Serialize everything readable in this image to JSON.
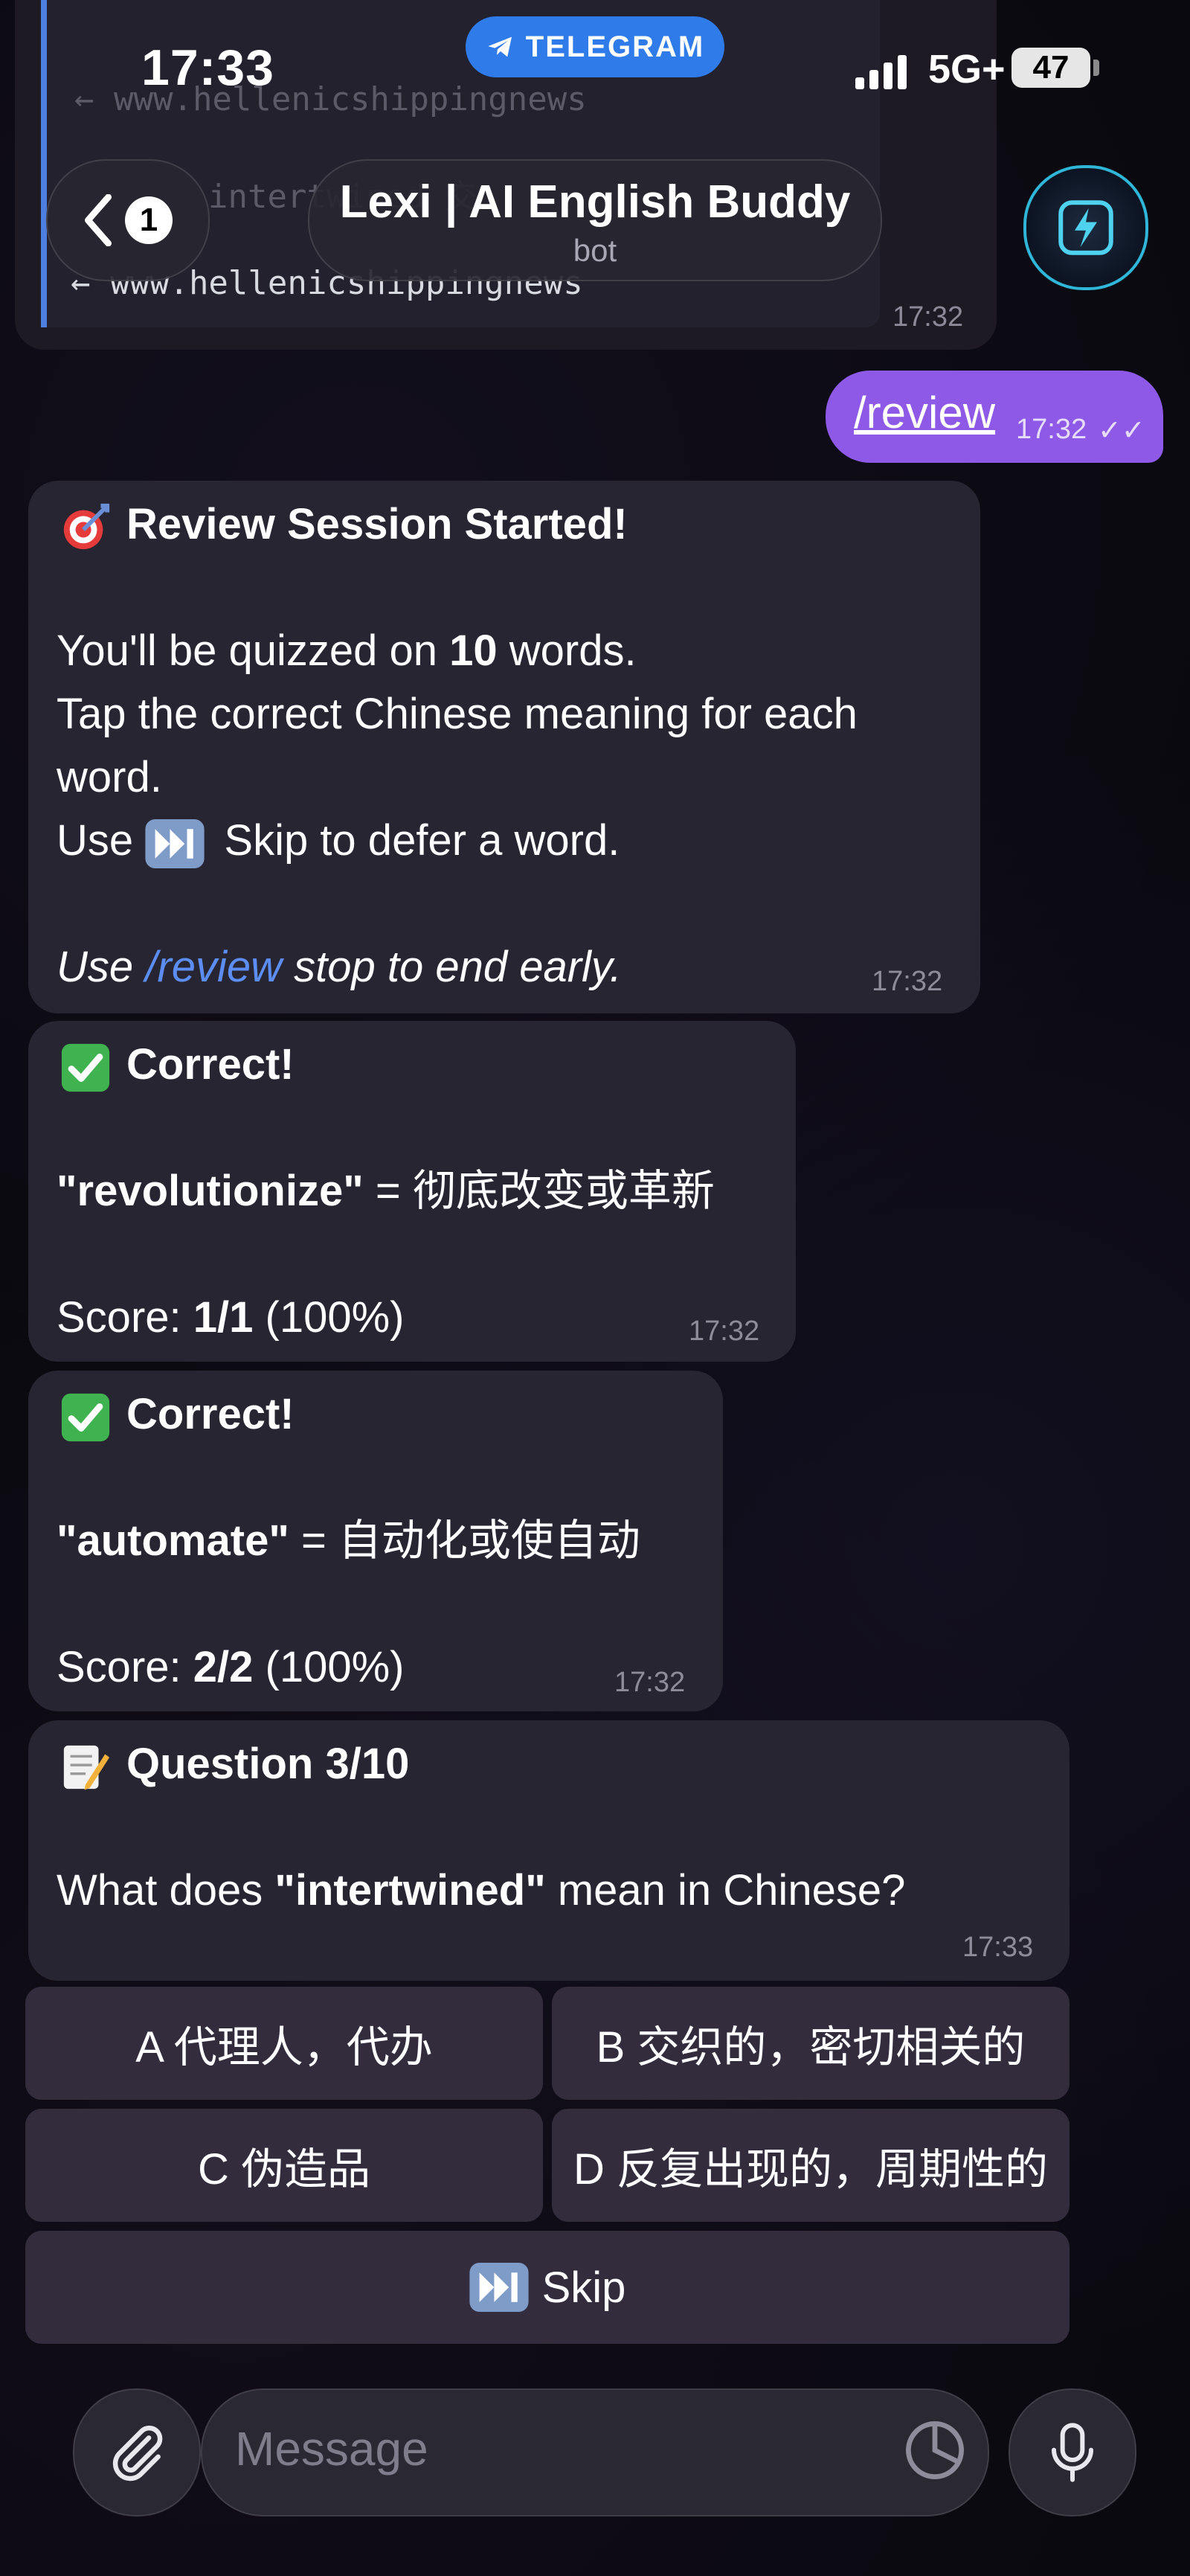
{
  "status": {
    "time": "17:33",
    "telegram_label": "TELEGRAM",
    "network": "5G+",
    "battery": "47"
  },
  "header": {
    "back_count": "1",
    "title": "Lexi | AI English Buddy",
    "subtitle": "bot"
  },
  "prev_message": {
    "link_text": "← www.hellenicshippingnews",
    "ghost_line_1": "← www.hellenicshippingnews",
    "ghost_line_2": "intertwined  交",
    "time": "17:32"
  },
  "outgoing": {
    "text": "/review",
    "time": "17:32"
  },
  "messages": {
    "m1": {
      "title": "Review Session Started!",
      "line1_pre": "You'll be quizzed on ",
      "line1_bold": "10",
      "line1_post": " words.",
      "line2": "Tap the correct Chinese meaning for each",
      "line3": "word.",
      "line4_pre": "Use ",
      "line4_post": " Skip to defer a word.",
      "line5_pre": "Use ",
      "line5_link": "/review",
      "line5_post": " stop to end early.",
      "time": "17:32"
    },
    "m2": {
      "title": "Correct!",
      "word": "\"revolutionize\"",
      "meaning": " = 彻底改变或革新",
      "score_label": "Score: ",
      "score_value": "1/1",
      "score_pct": " (100%)",
      "time": "17:32"
    },
    "m3": {
      "title": "Correct!",
      "word": "\"automate\"",
      "meaning": " = 自动化或使自动",
      "score_label": "Score: ",
      "score_value": "2/2",
      "score_pct": " (100%)",
      "time": "17:32"
    },
    "m4": {
      "title": "Question 3/10",
      "q_pre": "What does ",
      "q_word": "\"intertwined\"",
      "q_post": " mean in Chinese?",
      "time": "17:33"
    }
  },
  "keyboard": {
    "a": "A  代理人，代办",
    "b": "B  交织的，密切相关的",
    "c": "C  伪造品",
    "d": "D  反复出现的，周期性的",
    "skip": "Skip"
  },
  "input": {
    "placeholder": "Message"
  },
  "colors": {
    "accent": "#8e59e6",
    "telegram_blue": "#2f7bea",
    "link": "#5c8df2",
    "bubble": "#2a2634"
  }
}
